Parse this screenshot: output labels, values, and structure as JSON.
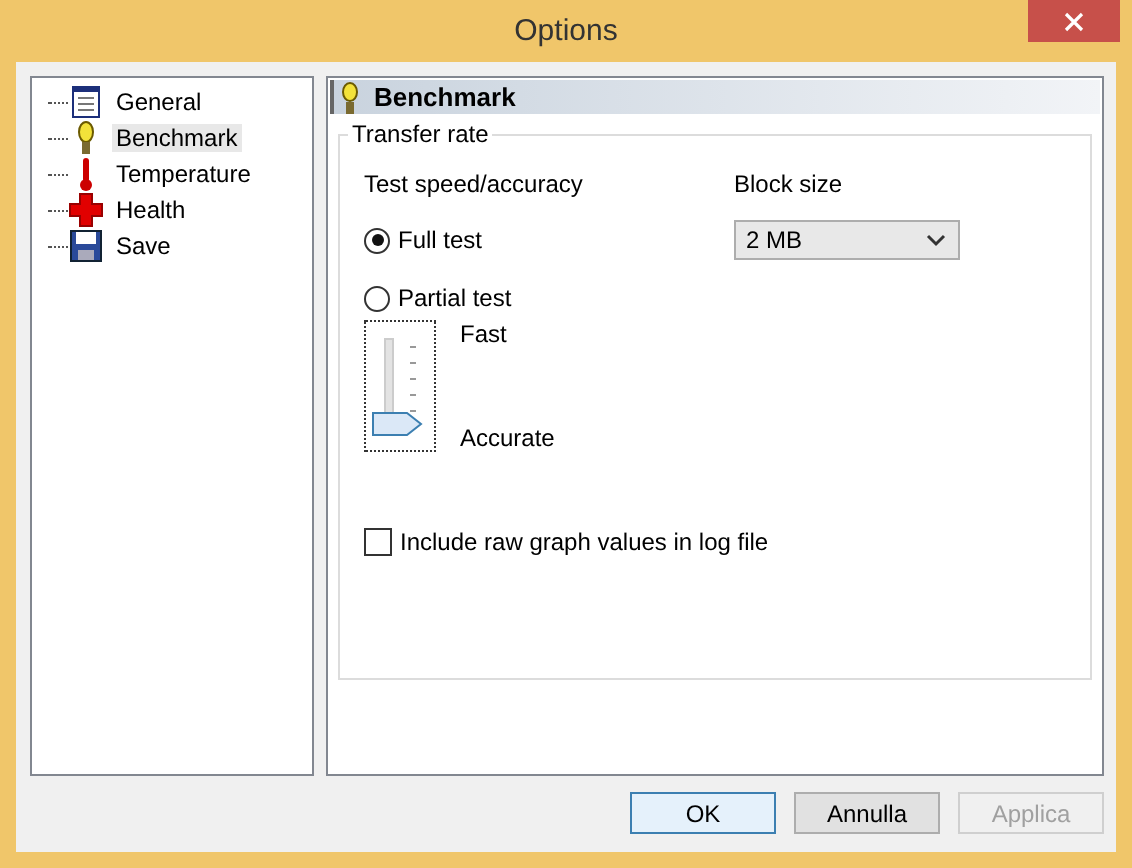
{
  "window": {
    "title": "Options"
  },
  "tree": [
    {
      "label": "General",
      "kind": "document",
      "selected": false
    },
    {
      "label": "Benchmark",
      "kind": "bulb",
      "selected": true
    },
    {
      "label": "Temperature",
      "kind": "thermometer",
      "selected": false
    },
    {
      "label": "Health",
      "kind": "cross",
      "selected": false
    },
    {
      "label": "Save",
      "kind": "disk",
      "selected": false
    }
  ],
  "page": {
    "title": "Benchmark",
    "group": "Transfer rate",
    "speed_label": "Test speed/accuracy",
    "block_label": "Block size",
    "block_value": "2 MB",
    "radios": [
      {
        "label": "Full test",
        "selected": true
      },
      {
        "label": "Partial test",
        "selected": false
      }
    ],
    "slider": {
      "top": "Fast",
      "bottom": "Accurate",
      "level": 0
    },
    "checkbox": {
      "label": "Include raw graph values in log file",
      "checked": false
    }
  },
  "buttons": [
    {
      "label": "OK",
      "disabled": false,
      "default": true
    },
    {
      "label": "Annulla",
      "disabled": false,
      "default": false
    },
    {
      "label": "Applica",
      "disabled": true,
      "default": false
    }
  ]
}
